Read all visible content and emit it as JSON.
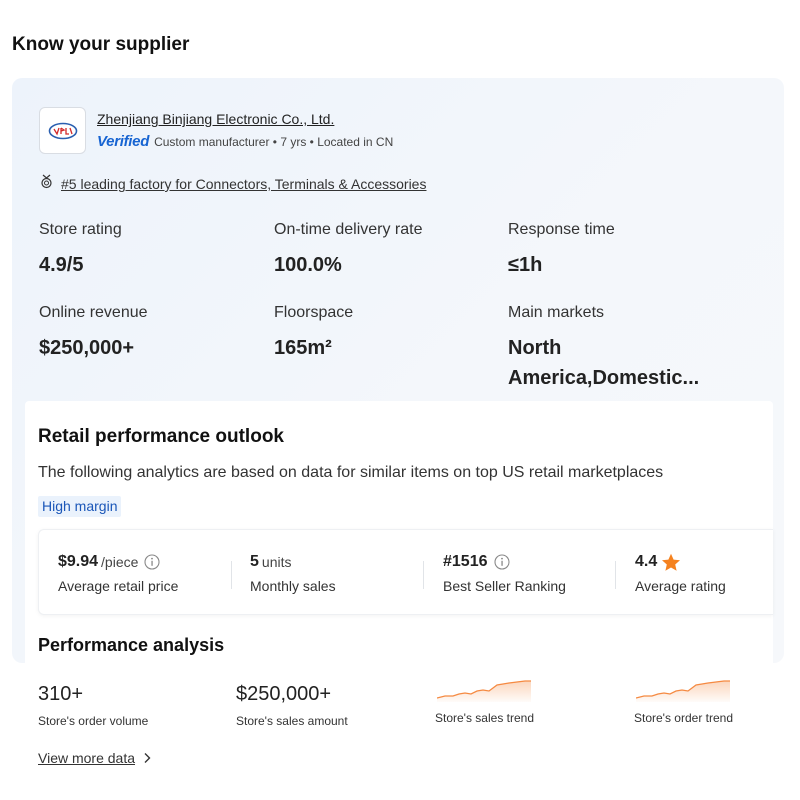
{
  "page": {
    "title": "Know your supplier"
  },
  "supplier": {
    "logo_icon": "company-logo",
    "name": "Zhenjiang Binjiang Electronic Co., Ltd.",
    "verified_label": "Verified",
    "meta": "Custom manufacturer • 7 yrs • Located in CN",
    "ranking_icon": "medal-icon",
    "ranking_text": "#5 leading factory for Connectors, Terminals & Accessories"
  },
  "stats": [
    {
      "label": "Store rating",
      "value": "4.9/5"
    },
    {
      "label": "On-time delivery rate",
      "value": "100.0%"
    },
    {
      "label": "Response time",
      "value": "≤1h"
    },
    {
      "label": "Online revenue",
      "value": "$250,000+"
    },
    {
      "label": "Floorspace",
      "value": "165m²"
    },
    {
      "label": "Main markets",
      "value_line1": "North",
      "value_line2": "America,Domestic..."
    }
  ],
  "retail": {
    "title": "Retail performance outlook",
    "description": "The following analytics are based on data for similar items on top US retail marketplaces",
    "tag": "High margin",
    "metrics": [
      {
        "value": "$9.94",
        "unit": "/piece",
        "label": "Average retail price",
        "icon": "info-icon"
      },
      {
        "value": "5",
        "unit": "units",
        "label": "Monthly sales"
      },
      {
        "value": "#1516",
        "unit": "",
        "label": "Best Seller Ranking",
        "icon": "info-icon"
      },
      {
        "value": "4.4",
        "unit": "",
        "label": "Average rating",
        "icon": "star-icon"
      }
    ]
  },
  "performance": {
    "title": "Performance analysis",
    "order_volume": {
      "value": "310+",
      "label": "Store's order volume"
    },
    "sales_amount": {
      "value": "$250,000+",
      "label": "Store's sales amount"
    },
    "sales_trend": {
      "label": "Store's sales trend"
    },
    "order_trend": {
      "label": "Store's order trend"
    },
    "view_more": "View more data"
  },
  "colors": {
    "accent": "#1764d2",
    "trend": "#f58a42",
    "star": "#f5821f",
    "tag_bg": "#eaf2fc"
  }
}
